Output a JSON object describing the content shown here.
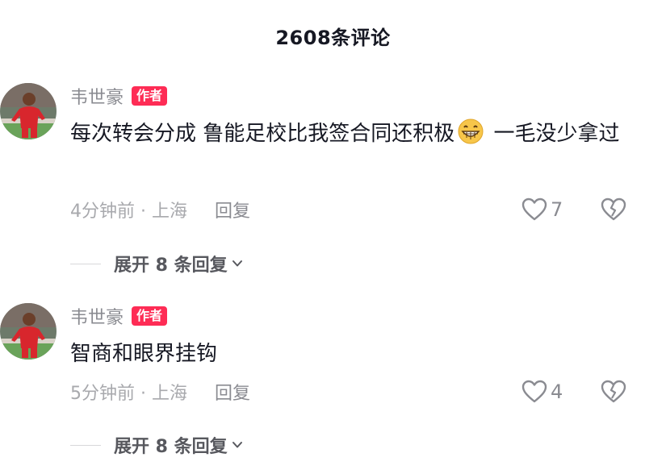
{
  "header": {
    "title": "2608条评论"
  },
  "comments": [
    {
      "username": "韦世豪",
      "badge": "作者",
      "text_before_emoji": "每次转会分成 鲁能足校比我签合同还积极",
      "emoji": "grinning-face-icon",
      "text_after_emoji": " 一毛没少拿过",
      "time_location": "4分钟前 · 上海",
      "reply_label": "回复",
      "like_count": "7",
      "expand_label": "展开 8 条回复"
    },
    {
      "username": "韦世豪",
      "badge": "作者",
      "text": "智商和眼界挂钩",
      "time_location": "5分钟前 · 上海",
      "reply_label": "回复",
      "like_count": "4",
      "expand_label": "展开 8 条回复"
    }
  ],
  "colors": {
    "badge_bg": "#fe2c55",
    "text_primary": "#161823",
    "text_secondary": "#8a8b91"
  },
  "icons": [
    "heart-outline-icon",
    "broken-heart-icon",
    "chevron-down-icon",
    "grinning-face-icon"
  ]
}
